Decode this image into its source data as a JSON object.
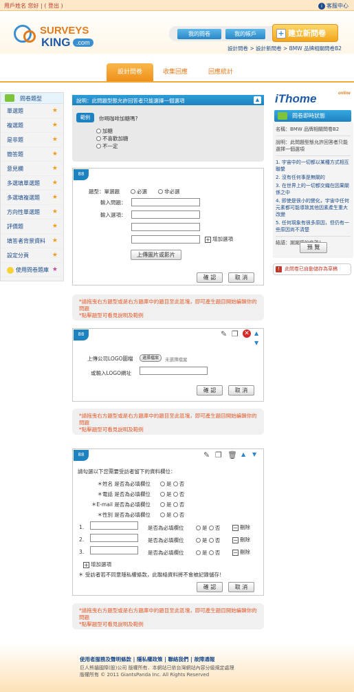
{
  "topbar": {
    "user": "用戶姓名 您好 | ( 登出 )",
    "help": "客服中心"
  },
  "logo": {
    "line1": "SURVEYS",
    "line2": "KING",
    "dotcom": ".com"
  },
  "nav": {
    "my_survey": "我的問卷",
    "my_account": "我的帳戶",
    "new_survey": "建立新問卷"
  },
  "breadcrumb": "設計問卷 > 設計新問卷 > BMW 品牌相關問卷B2",
  "tabs": [
    "設計問卷",
    "收集回應",
    "回應統計"
  ],
  "sidebar": {
    "title": "問卷題型",
    "items": [
      "單選題",
      "複選題",
      "是非題",
      "簡答題",
      "意見欄",
      "多選填單選題",
      "多選填複選題",
      "方向性單選題",
      "評價題",
      "填答者背景資料",
      "設定分頁"
    ],
    "bank": "使用問卷題庫"
  },
  "intro": {
    "header": "說明：此問題型態允許回答者只能選擇一個選項",
    "example_tag": "範例",
    "question": "你喝咖啡加糖嗎?",
    "options": [
      "加糖",
      "不喜歡加糖",
      "不一定"
    ]
  },
  "q1": {
    "num": "88",
    "type_label": "題型：單選題",
    "required": "必選",
    "not_required": "非必選",
    "q_label": "輸入問題：",
    "opt_label": "輸入選項：",
    "add_opt": "增加選項",
    "upload": "上傳圖片或影片",
    "ok": "確 認",
    "cancel": "取 消"
  },
  "note": {
    "line1": "*請拖曳右方題型或是右方題庫中的題目至此區塊，即可產生題目開始編輯你的問題",
    "line2": "*點擊題型可看見說明及範例"
  },
  "q2": {
    "num": "88",
    "logo_label": "上傳公司LOGO圖檔",
    "choose": "選擇檔案",
    "no_file": "未選擇檔案",
    "url_label": "或輸入LOGO網址",
    "ok": "確 認",
    "cancel": "取 消"
  },
  "q3": {
    "num": "88",
    "intro": "請勾選以下您需要受訪者留下的資料欄位：",
    "fields": [
      {
        "name": "＊姓名",
        "req": "是否為必填欄位",
        "yes": "是",
        "no": "否"
      },
      {
        "name": "＊電話",
        "req": "是否為必填欄位",
        "yes": "是",
        "no": "否"
      },
      {
        "name": "＊E-mail",
        "req": "是否為必填欄位",
        "yes": "是",
        "no": "否"
      },
      {
        "name": "＊性別",
        "req": "是否為必填欄位",
        "yes": "是",
        "no": "否"
      }
    ],
    "rows": [
      {
        "n": "1.",
        "req": "是否為必填欄位",
        "yes": "是",
        "no": "否",
        "del": "刪除"
      },
      {
        "n": "2.",
        "req": "是否為必填欄位",
        "yes": "是",
        "no": "否",
        "del": "刪除"
      },
      {
        "n": "3.",
        "req": "是否為必填欄位",
        "yes": "是",
        "no": "否",
        "del": "刪除"
      }
    ],
    "add_opt": "增加選項",
    "privacy": "＊ 受訪者若不同意隱私權條款，此聯絡資料將不會被記錄儲存！",
    "ok": "確 認",
    "cancel": "取 消"
  },
  "right": {
    "brand": "iThome",
    "brand_sup": "online",
    "status_title": "問卷即時狀態",
    "name": "名稱：BMW 品牌相關問卷B2",
    "desc": "說明：此問題型態允許回答者只能選擇一個選項",
    "list": [
      "1. 宇宙中的一切都以某種方式相互聯繫",
      "2. 沒有任何事是無關的",
      "3. 在世界上的一切都交織在因果關係之中",
      "4. 即使是很小的變化，宇宙中任何元素都可能導致其他因素產生重大改變",
      "5. 任何現象有很多原因，但仍有一些原因尚不清楚"
    ],
    "ending": "結語：謝謝您的作答！",
    "preview": "預 覽",
    "autosave": "此問卷已自動儲存為草稿"
  },
  "footer": {
    "links": "使用者服務及聲明條款 | 隱私權政策 | 聯絡我們 | 故障通報",
    "c1": "巨人熊貓國際(股)公司 版權所有．本網站已依台灣網站內容分級規定處理",
    "c2": "版權所有 © 2011 GiantsPanda Inc. All Rights Reserved"
  }
}
